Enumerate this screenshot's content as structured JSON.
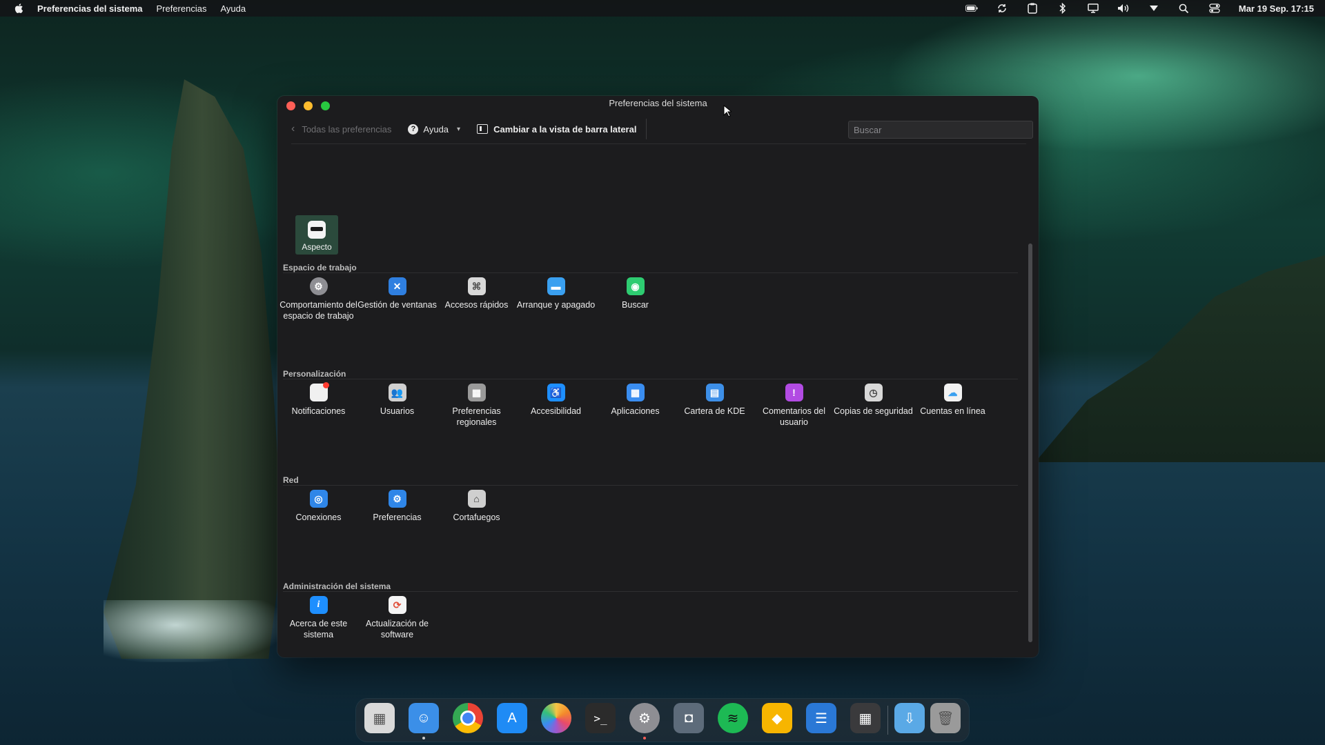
{
  "menubar": {
    "app_name": "Preferencias del sistema",
    "menus": [
      "Preferencias",
      "Ayuda"
    ],
    "clock": "Mar 19 Sep. 17:15"
  },
  "window": {
    "title": "Preferencias del sistema",
    "toolbar": {
      "back_label": "Todas las preferencias",
      "help_label": "Ayuda",
      "switch_label": "Cambiar a la vista de barra lateral",
      "search_placeholder": "Buscar"
    },
    "featured": {
      "label": "Aspecto",
      "icon": "appearance-icon"
    },
    "sections": [
      {
        "title": "Espacio de trabajo",
        "items": [
          {
            "label": "Comportamiento del espacio de trabajo",
            "icon": "gear-icon",
            "color": "#8e8e93"
          },
          {
            "label": "Gestión de ventanas",
            "icon": "window-management-icon",
            "color": "#2f7fe0"
          },
          {
            "label": "Accesos rápidos",
            "icon": "shortcuts-icon",
            "color": "#d8d8d8"
          },
          {
            "label": "Arranque y apagado",
            "icon": "startup-icon",
            "color": "#3aa0f0"
          },
          {
            "label": "Buscar",
            "icon": "search-icon",
            "color": "#2ecc71"
          }
        ]
      },
      {
        "title": "Personalización",
        "items": [
          {
            "label": "Notificaciones",
            "icon": "notifications-icon",
            "color": "#f0f0f0"
          },
          {
            "label": "Usuarios",
            "icon": "users-icon",
            "color": "#d0d0d0"
          },
          {
            "label": "Preferencias regionales",
            "icon": "regional-icon",
            "color": "#9a9a9a"
          },
          {
            "label": "Accesibilidad",
            "icon": "accessibility-icon",
            "color": "#1e8fff"
          },
          {
            "label": "Aplicaciones",
            "icon": "applications-icon",
            "color": "#3a8df0"
          },
          {
            "label": "Cartera de KDE",
            "icon": "wallet-icon",
            "color": "#3d8fe8"
          },
          {
            "label": "Comentarios del usuario",
            "icon": "feedback-icon",
            "color": "#b24be3"
          },
          {
            "label": "Copias de seguridad",
            "icon": "backup-icon",
            "color": "#d8d8d8"
          },
          {
            "label": "Cuentas en línea",
            "icon": "cloud-icon",
            "color": "#f2f2f2"
          }
        ]
      },
      {
        "title": "Red",
        "items": [
          {
            "label": "Conexiones",
            "icon": "connections-icon",
            "color": "#2f86e8"
          },
          {
            "label": "Preferencias",
            "icon": "network-preferences-icon",
            "color": "#2f86e8"
          },
          {
            "label": "Cortafuegos",
            "icon": "firewall-icon",
            "color": "#cfcfcf"
          }
        ]
      },
      {
        "title": "Administración del sistema",
        "items": [
          {
            "label": "Acerca de este sistema",
            "icon": "info-icon",
            "color": "#1e8fff"
          },
          {
            "label": "Actualización de software",
            "icon": "software-update-icon",
            "color": "#f4f4f4"
          }
        ]
      }
    ]
  },
  "dock": {
    "items": [
      {
        "icon": "launchpad-icon",
        "color": "#d9d9d9"
      },
      {
        "icon": "finder-icon",
        "color": "#3b8fe8"
      },
      {
        "icon": "chrome-icon",
        "color": "#ea4335"
      },
      {
        "icon": "app-store-icon",
        "color": "#1f8bf5"
      },
      {
        "icon": "photos-icon",
        "color": "#f6c545"
      },
      {
        "icon": "terminal-icon",
        "color": "#2b2b2b"
      },
      {
        "icon": "system-preferences-icon",
        "color": "#8e8e93"
      },
      {
        "icon": "screenshot-icon",
        "color": "#5d6b7a"
      },
      {
        "icon": "spotify-icon",
        "color": "#1db954"
      },
      {
        "icon": "sketch-icon",
        "color": "#f7b500"
      },
      {
        "icon": "text-editor-icon",
        "color": "#2a78d6"
      },
      {
        "icon": "calculator-icon",
        "color": "#3a3a3c"
      },
      {
        "icon": "downloads-folder-icon",
        "color": "#5aa9e6"
      },
      {
        "icon": "trash-icon",
        "color": "#9a9a9a"
      }
    ]
  }
}
